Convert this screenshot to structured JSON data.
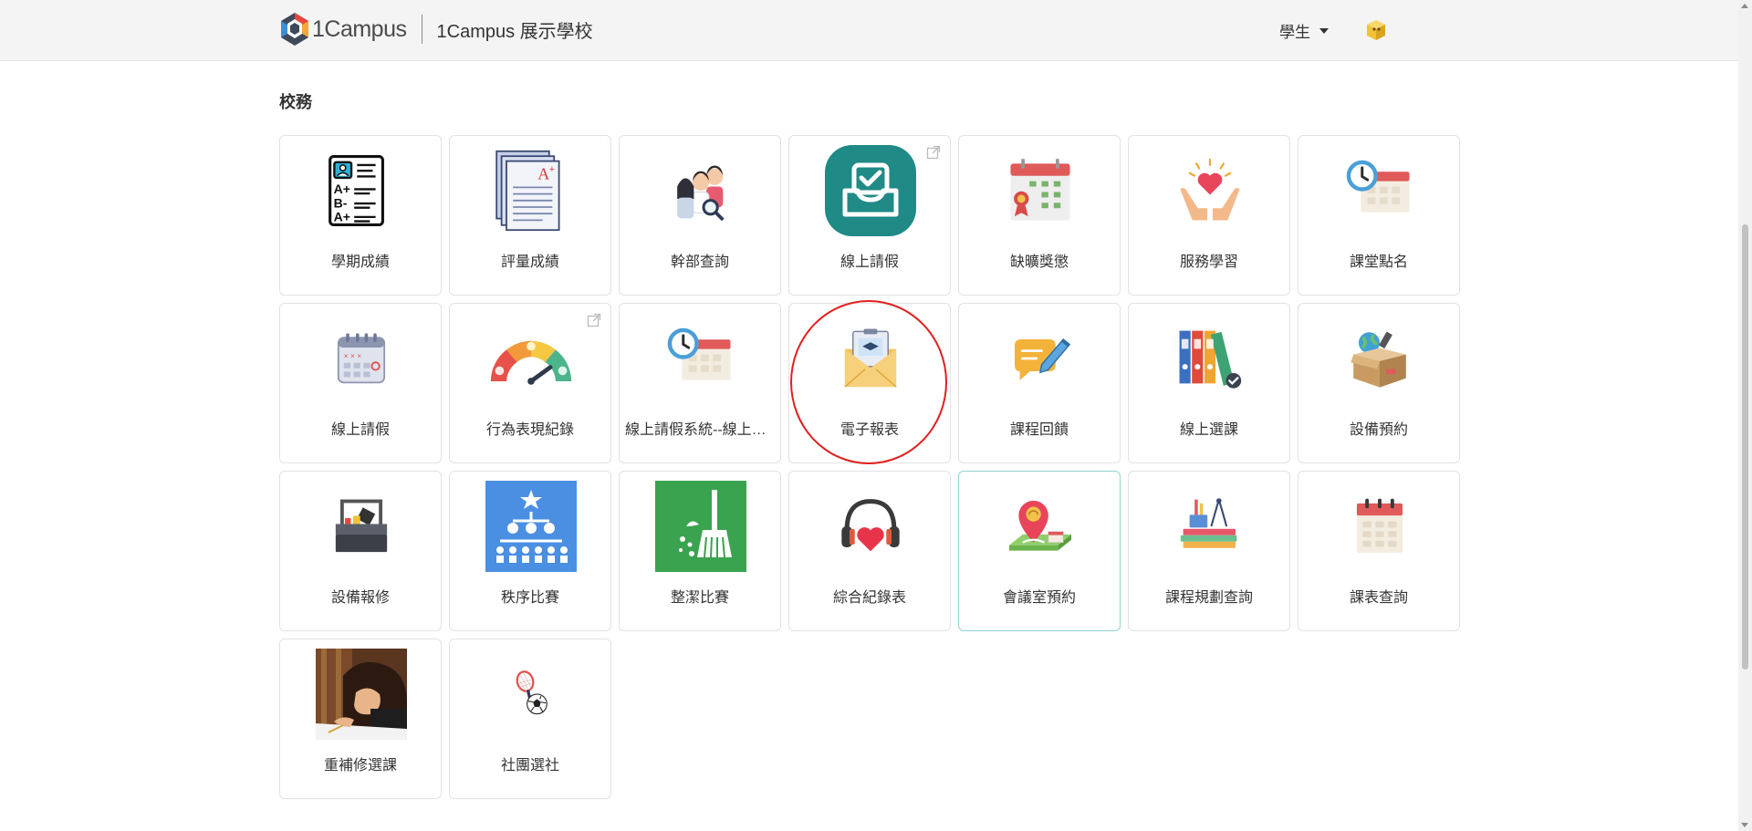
{
  "header": {
    "logo_text": "1Campus",
    "school_name": "1Campus 展示學校",
    "role_label": "學生"
  },
  "section": {
    "title": "校務"
  },
  "apps": [
    {
      "label": "學期成績",
      "icon": "report-card-icon",
      "external": false
    },
    {
      "label": "評量成績",
      "icon": "graded-papers-icon",
      "external": false
    },
    {
      "label": "幹部查詢",
      "icon": "students-search-icon",
      "external": false
    },
    {
      "label": "線上請假",
      "icon": "inbox-check-icon",
      "external": true
    },
    {
      "label": "缺曠獎懲",
      "icon": "calendar-award-icon",
      "external": false
    },
    {
      "label": "服務學習",
      "icon": "hands-heart-icon",
      "external": false
    },
    {
      "label": "課堂點名",
      "icon": "clock-calendar-icon",
      "external": false
    },
    {
      "label": "線上請假",
      "icon": "marked-calendar-icon",
      "external": false
    },
    {
      "label": "行為表現紀錄",
      "icon": "gauge-icon",
      "external": true
    },
    {
      "label": "線上請假系統--線上請假",
      "icon": "clock-calendar-icon",
      "external": false
    },
    {
      "label": "電子報表",
      "icon": "envelope-report-icon",
      "external": false
    },
    {
      "label": "課程回饋",
      "icon": "chat-pencil-icon",
      "external": false
    },
    {
      "label": "線上選課",
      "icon": "binders-icon",
      "external": false
    },
    {
      "label": "設備預約",
      "icon": "equipment-box-icon",
      "external": false
    },
    {
      "label": "設備報修",
      "icon": "toolbox-icon",
      "external": false
    },
    {
      "label": "秩序比賽",
      "icon": "hierarchy-icon",
      "external": false
    },
    {
      "label": "整潔比賽",
      "icon": "broom-icon",
      "external": false
    },
    {
      "label": "綜合紀錄表",
      "icon": "headphones-heart-icon",
      "external": false
    },
    {
      "label": "會議室預約",
      "icon": "map-pin-icon",
      "external": false
    },
    {
      "label": "課程規劃查詢",
      "icon": "books-tools-icon",
      "external": false
    },
    {
      "label": "課表查詢",
      "icon": "calendar-icon",
      "external": false
    },
    {
      "label": "重補修選課",
      "icon": "student-writing-photo",
      "external": false
    },
    {
      "label": "社團選社",
      "icon": "racket-ball-icon",
      "external": false
    }
  ],
  "colors": {
    "header_bg": "#f4f4f4",
    "teal": "#1f8a86",
    "highlight_circle": "#e0201f",
    "active_border": "#8fd3d3"
  }
}
